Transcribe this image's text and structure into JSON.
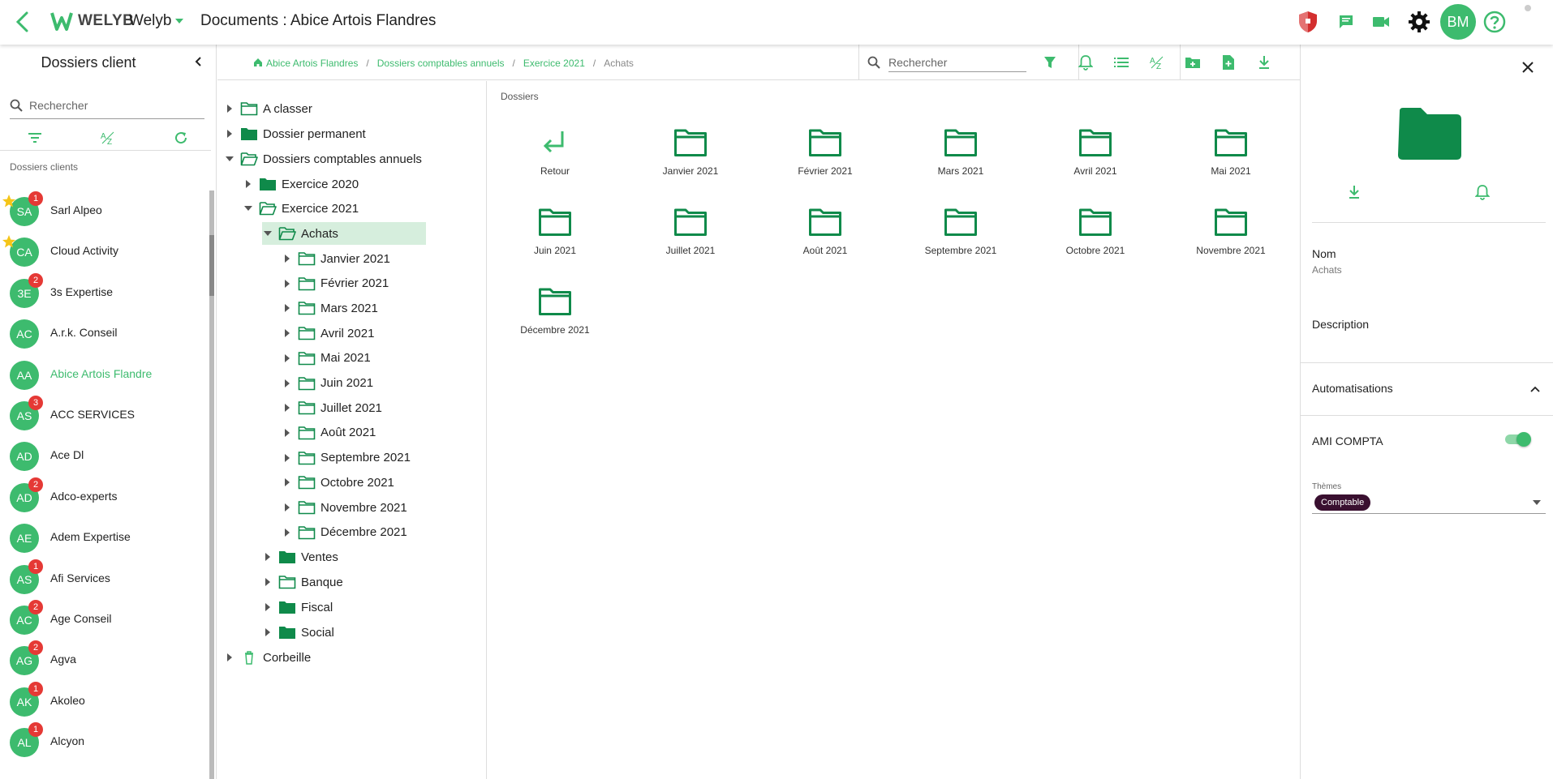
{
  "app": {
    "brand_bold": "WELYB",
    "brand_name": "Welyb",
    "page_title": "Documents : Abice Artois Flandres",
    "user_initials": "BM",
    "colors": {
      "accent": "#3dbb6e",
      "folder": "#0f8a4a",
      "badge": "#e53935",
      "shield": "#d32f2f",
      "chip": "#3a1030"
    }
  },
  "sidebar": {
    "title": "Dossiers client",
    "search_placeholder": "Rechercher",
    "section_label": "Dossiers clients",
    "clients": [
      {
        "initials": "SA",
        "name": "Sarl Alpeo",
        "badge": "1",
        "star": true
      },
      {
        "initials": "CA",
        "name": "Cloud Activity",
        "badge": "",
        "star": true
      },
      {
        "initials": "3E",
        "name": "3s Expertise",
        "badge": "2",
        "star": false
      },
      {
        "initials": "AC",
        "name": "A.r.k. Conseil",
        "badge": "",
        "star": false
      },
      {
        "initials": "AA",
        "name": "Abice Artois Flandre",
        "badge": "",
        "star": false,
        "active": true
      },
      {
        "initials": "AS",
        "name": "ACC SERVICES",
        "badge": "3",
        "star": false
      },
      {
        "initials": "AD",
        "name": "Ace Dl",
        "badge": "",
        "star": false
      },
      {
        "initials": "AD",
        "name": "Adco-experts",
        "badge": "2",
        "star": false
      },
      {
        "initials": "AE",
        "name": "Adem Expertise",
        "badge": "",
        "star": false
      },
      {
        "initials": "AS",
        "name": "Afi Services",
        "badge": "1",
        "star": false
      },
      {
        "initials": "AC",
        "name": "Age Conseil",
        "badge": "2",
        "star": false
      },
      {
        "initials": "AG",
        "name": "Agva",
        "badge": "2",
        "star": false
      },
      {
        "initials": "AK",
        "name": "Akoleo",
        "badge": "1",
        "star": false
      },
      {
        "initials": "AL",
        "name": "Alcyon",
        "badge": "1",
        "star": false
      }
    ]
  },
  "breadcrumb": {
    "items": [
      "Abice Artois Flandres",
      "Dossiers comptables annuels",
      "Exercice 2021"
    ],
    "current": "Achats"
  },
  "toolbar": {
    "search_placeholder": "Rechercher"
  },
  "tree": {
    "a_classer": "A classer",
    "dossier_permanent": "Dossier permanent",
    "dossiers_comptables": "Dossiers comptables annuels",
    "exercice_2020": "Exercice 2020",
    "exercice_2021": "Exercice 2021",
    "achats": "Achats",
    "months": [
      "Janvier 2021",
      "Février 2021",
      "Mars 2021",
      "Avril 2021",
      "Mai 2021",
      "Juin 2021",
      "Juillet 2021",
      "Août 2021",
      "Septembre 2021",
      "Octobre 2021",
      "Novembre 2021",
      "Décembre 2021"
    ],
    "ventes": "Ventes",
    "banque": "Banque",
    "fiscal": "Fiscal",
    "social": "Social",
    "corbeille": "Corbeille"
  },
  "main": {
    "title": "Dossiers",
    "back_label": "Retour",
    "folders": [
      "Janvier 2021",
      "Février 2021",
      "Mars 2021",
      "Avril 2021",
      "Mai 2021",
      "Juin 2021",
      "Juillet 2021",
      "Août 2021",
      "Septembre 2021",
      "Octobre 2021",
      "Novembre 2021",
      "Décembre 2021"
    ]
  },
  "details": {
    "name_label": "Nom",
    "name_value": "Achats",
    "description_label": "Description",
    "automations_label": "Automatisations",
    "ami_compta_label": "AMI COMPTA",
    "ami_compta_enabled": true,
    "themes_label": "Thèmes",
    "theme_chip": "Comptable"
  }
}
